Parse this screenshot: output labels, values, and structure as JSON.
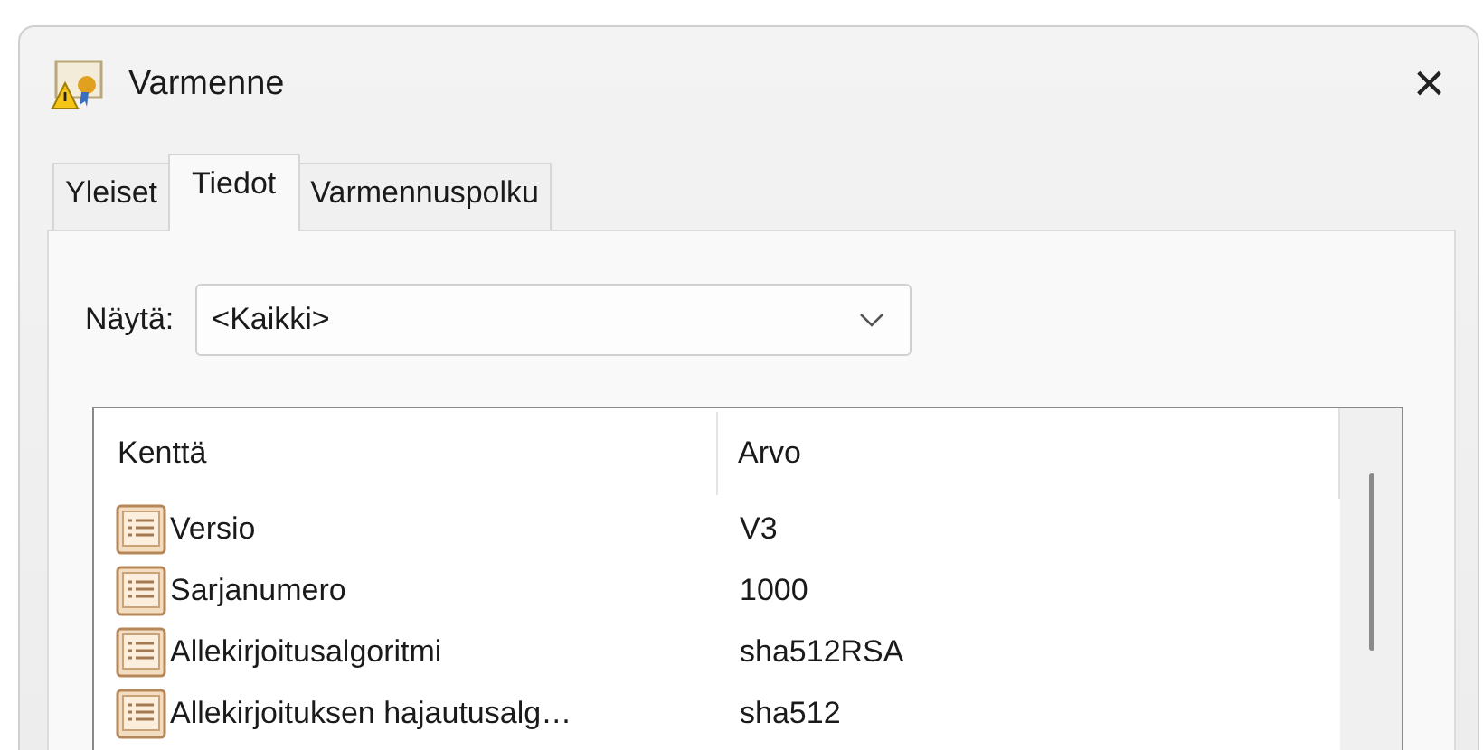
{
  "window": {
    "title": "Varmenne",
    "close": "×"
  },
  "tabs": [
    {
      "label": "Yleiset",
      "selected": false
    },
    {
      "label": "Tiedot",
      "selected": true
    },
    {
      "label": "Varmennuspolku",
      "selected": false
    }
  ],
  "filter": {
    "label": "Näytä:",
    "value": "<Kaikki>"
  },
  "table": {
    "columns": [
      "Kenttä",
      "Arvo"
    ],
    "rows": [
      {
        "field": "Versio",
        "value": "V3"
      },
      {
        "field": "Sarjanumero",
        "value": "1000"
      },
      {
        "field": "Allekirjoitusalgoritmi",
        "value": "sha512RSA"
      },
      {
        "field": "Allekirjoituksen hajautusalg…",
        "value": "sha512"
      }
    ]
  }
}
